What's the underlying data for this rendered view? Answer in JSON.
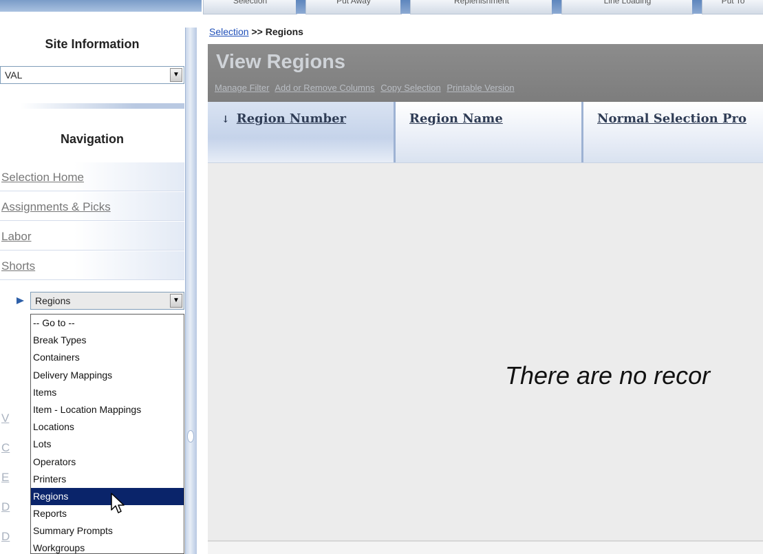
{
  "top_tabs": [
    "Selection",
    "Put Away",
    "Replenishment",
    "Line Loading",
    "Put To"
  ],
  "sidebar": {
    "site_title": "Site Information",
    "site_select": "VAL",
    "nav_title": "Navigation",
    "links": [
      "Selection Home",
      "Assignments & Picks",
      "Labor",
      "Shorts"
    ],
    "goto_select": "Regions",
    "goto_options": [
      "-- Go to --",
      "Break Types",
      "Containers",
      "Delivery Mappings",
      "Items",
      "Item - Location Mappings",
      "Locations",
      "Lots",
      "Operators",
      "Printers",
      "Regions",
      "Reports",
      "Summary Prompts",
      "Workgroups"
    ],
    "selected_option": "Regions",
    "hidden_link_initials": [
      "V",
      "C",
      "E",
      "D",
      "D"
    ]
  },
  "breadcrumb": {
    "link": "Selection",
    "sep": " >> ",
    "current": "Regions"
  },
  "panel": {
    "title": "View Regions",
    "links": [
      "Manage Filter",
      "Add or Remove Columns",
      "Copy Selection",
      "Printable Version"
    ]
  },
  "grid": {
    "columns": [
      "Region Number",
      "Region Name",
      "Normal Selection Pro"
    ],
    "sort_indicator": "↓",
    "empty_message": "There are no recor"
  },
  "icons": [
    "dropdown-arrow-icon",
    "current-page-arrow-icon",
    "sort-down-icon",
    "mouse-cursor-icon"
  ]
}
